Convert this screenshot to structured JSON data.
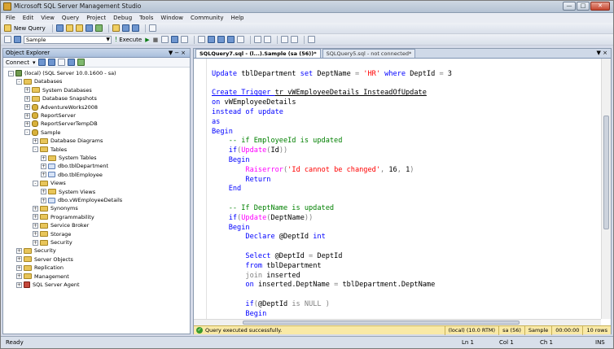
{
  "window": {
    "title": "Microsoft SQL Server Management Studio"
  },
  "menu": [
    "File",
    "Edit",
    "View",
    "Query",
    "Project",
    "Debug",
    "Tools",
    "Window",
    "Community",
    "Help"
  ],
  "toolbar": {
    "new_query": "New Query",
    "database": "Sample",
    "execute": "Execute"
  },
  "object_explorer": {
    "title": "Object Explorer",
    "connect": "Connect",
    "nodes": [
      {
        "label": "(local) (SQL Server 10.0.1600 - sa)",
        "depth": 0,
        "icon": "server",
        "exp": "-"
      },
      {
        "label": "Databases",
        "depth": 1,
        "icon": "folder",
        "exp": "-"
      },
      {
        "label": "System Databases",
        "depth": 2,
        "icon": "folder",
        "exp": "+"
      },
      {
        "label": "Database Snapshots",
        "depth": 2,
        "icon": "folder",
        "exp": "+"
      },
      {
        "label": "AdventureWorks2008",
        "depth": 2,
        "icon": "db",
        "exp": "+"
      },
      {
        "label": "ReportServer",
        "depth": 2,
        "icon": "db",
        "exp": "+"
      },
      {
        "label": "ReportServerTempDB",
        "depth": 2,
        "icon": "db",
        "exp": "+"
      },
      {
        "label": "Sample",
        "depth": 2,
        "icon": "db",
        "exp": "-"
      },
      {
        "label": "Database Diagrams",
        "depth": 3,
        "icon": "folder",
        "exp": "+"
      },
      {
        "label": "Tables",
        "depth": 3,
        "icon": "folder",
        "exp": "-"
      },
      {
        "label": "System Tables",
        "depth": 4,
        "icon": "folder",
        "exp": "+"
      },
      {
        "label": "dbo.tblDepartment",
        "depth": 4,
        "icon": "table",
        "exp": "+"
      },
      {
        "label": "dbo.tblEmployee",
        "depth": 4,
        "icon": "table",
        "exp": "+"
      },
      {
        "label": "Views",
        "depth": 3,
        "icon": "folder",
        "exp": "-"
      },
      {
        "label": "System Views",
        "depth": 4,
        "icon": "folder",
        "exp": "+"
      },
      {
        "label": "dbo.vWEmployeeDetails",
        "depth": 4,
        "icon": "table",
        "exp": "+"
      },
      {
        "label": "Synonyms",
        "depth": 3,
        "icon": "folder",
        "exp": "+"
      },
      {
        "label": "Programmability",
        "depth": 3,
        "icon": "folder",
        "exp": "+"
      },
      {
        "label": "Service Broker",
        "depth": 3,
        "icon": "folder",
        "exp": "+"
      },
      {
        "label": "Storage",
        "depth": 3,
        "icon": "folder",
        "exp": "+"
      },
      {
        "label": "Security",
        "depth": 3,
        "icon": "folder",
        "exp": "+"
      },
      {
        "label": "Security",
        "depth": 1,
        "icon": "folder",
        "exp": "+"
      },
      {
        "label": "Server Objects",
        "depth": 1,
        "icon": "folder",
        "exp": "+"
      },
      {
        "label": "Replication",
        "depth": 1,
        "icon": "folder",
        "exp": "+"
      },
      {
        "label": "Management",
        "depth": 1,
        "icon": "folder",
        "exp": "+"
      },
      {
        "label": "SQL Server Agent",
        "depth": 1,
        "icon": "agent",
        "exp": "+"
      }
    ]
  },
  "editor": {
    "tabs": [
      {
        "label": "SQLQuery7.sql - (l...).Sample (sa (56))*",
        "active": true
      },
      {
        "label": "SQLQuery5.sql - not connected*",
        "active": false
      }
    ],
    "lines": [
      [],
      [
        [
          "kw",
          "Update "
        ],
        [
          "",
          "tblDepartment "
        ],
        [
          "kw",
          "set "
        ],
        [
          "",
          "DeptName "
        ],
        [
          "gr",
          "= "
        ],
        [
          "str",
          "'HR' "
        ],
        [
          "kw",
          "where "
        ],
        [
          "",
          "DeptId "
        ],
        [
          "gr",
          "= "
        ],
        [
          "",
          "3"
        ]
      ],
      [],
      [
        [
          "kw",
          "Create Trigger "
        ],
        [
          "",
          "tr_vWEmployeeDetails_InsteadOfUpdate"
        ]
      ],
      [
        [
          "kw",
          "on "
        ],
        [
          "",
          "vWEmployeeDetails"
        ]
      ],
      [
        [
          "kw",
          "instead of update"
        ]
      ],
      [
        [
          "kw",
          "as"
        ]
      ],
      [
        [
          "kw",
          "Begin"
        ]
      ],
      [
        [
          "",
          "    "
        ],
        [
          "cm",
          "-- if EmployeeId is updated"
        ]
      ],
      [
        [
          "",
          "    "
        ],
        [
          "kw",
          "if"
        ],
        [
          "gr",
          "("
        ],
        [
          "fn",
          "Update"
        ],
        [
          "gr",
          "("
        ],
        [
          "",
          "Id"
        ],
        [
          "gr",
          "))"
        ]
      ],
      [
        [
          "",
          "    "
        ],
        [
          "kw",
          "Begin"
        ]
      ],
      [
        [
          "",
          "        "
        ],
        [
          "fn",
          "Raiserror"
        ],
        [
          "gr",
          "("
        ],
        [
          "str",
          "'Id cannot be changed'"
        ],
        [
          "gr",
          ", "
        ],
        [
          "",
          "16"
        ],
        [
          "gr",
          ", "
        ],
        [
          "",
          "1"
        ],
        [
          "gr",
          ")"
        ]
      ],
      [
        [
          "",
          "        "
        ],
        [
          "kw",
          "Return"
        ]
      ],
      [
        [
          "",
          "    "
        ],
        [
          "kw",
          "End"
        ]
      ],
      [],
      [
        [
          "",
          "    "
        ],
        [
          "cm",
          "-- If DeptName is updated"
        ]
      ],
      [
        [
          "",
          "    "
        ],
        [
          "kw",
          "if"
        ],
        [
          "gr",
          "("
        ],
        [
          "fn",
          "Update"
        ],
        [
          "gr",
          "("
        ],
        [
          "",
          "DeptName"
        ],
        [
          "gr",
          "))"
        ]
      ],
      [
        [
          "",
          "    "
        ],
        [
          "kw",
          "Begin"
        ]
      ],
      [
        [
          "",
          "        "
        ],
        [
          "kw",
          "Declare "
        ],
        [
          "",
          "@DeptId "
        ],
        [
          "kw",
          "int"
        ]
      ],
      [],
      [
        [
          "",
          "        "
        ],
        [
          "kw",
          "Select "
        ],
        [
          "",
          "@DeptId "
        ],
        [
          "gr",
          "= "
        ],
        [
          "",
          "DeptId"
        ]
      ],
      [
        [
          "",
          "        "
        ],
        [
          "kw",
          "from "
        ],
        [
          "",
          "tblDepartment"
        ]
      ],
      [
        [
          "",
          "        "
        ],
        [
          "gr",
          "join "
        ],
        [
          "",
          "inserted"
        ]
      ],
      [
        [
          "",
          "        "
        ],
        [
          "kw",
          "on "
        ],
        [
          "",
          "inserted.DeptName "
        ],
        [
          "gr",
          "= "
        ],
        [
          "",
          "tblDepartment.DeptName"
        ]
      ],
      [],
      [
        [
          "",
          "        "
        ],
        [
          "kw",
          "if"
        ],
        [
          "gr",
          "("
        ],
        [
          "",
          "@DeptId "
        ],
        [
          "gr",
          "is "
        ],
        [
          "gr",
          "NULL "
        ],
        [
          "gr",
          ")"
        ]
      ],
      [
        [
          "",
          "        "
        ],
        [
          "kw",
          "Begin"
        ]
      ]
    ]
  },
  "query_status": {
    "message": "Query executed successfully.",
    "server": "(local) (10.0 RTM)",
    "user": "sa (56)",
    "database": "Sample",
    "time": "00:00:00",
    "rows": "10 rows"
  },
  "statusbar": {
    "ready": "Ready",
    "ln": "Ln 1",
    "col": "Col 1",
    "ch": "Ch 1",
    "ins": "INS"
  }
}
